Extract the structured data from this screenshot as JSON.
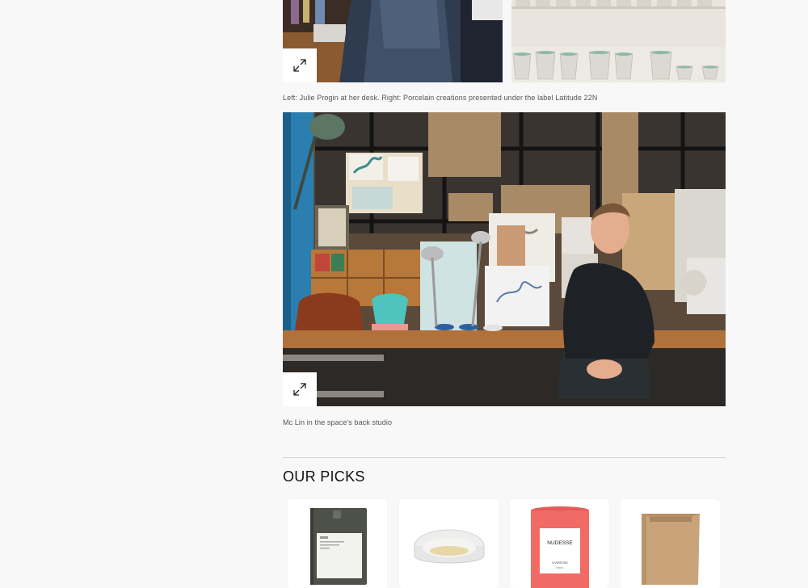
{
  "gallery": {
    "top_left_image": {
      "alt_icon": "person-at-desk-photo"
    },
    "top_right_image": {
      "alt_icon": "porcelain-cups-photo"
    },
    "top_caption": "Left: Julie Progin at her desk. Right: Porcelain creations presented under the label Latitude 22N",
    "studio_image": {
      "alt_icon": "studio-photo"
    },
    "studio_caption": "Mc Lin in the space's back studio"
  },
  "expand_icon": "expand-diagonal-icon",
  "picks": {
    "title": "OUR PICKS",
    "items": [
      {
        "icon": "notebook-product",
        "label": ""
      },
      {
        "icon": "glass-dish-product",
        "label": ""
      },
      {
        "icon": "candle-product",
        "brand": "NUDESSE",
        "sub": "OVEROSE",
        "sub2": "PARIS"
      },
      {
        "icon": "kraft-box-product",
        "label": ""
      }
    ]
  },
  "colors": {
    "background": "#f8f8f8",
    "candle": "#f06a66",
    "kraft": "#c9a47a",
    "notebook": "#4d5147"
  }
}
